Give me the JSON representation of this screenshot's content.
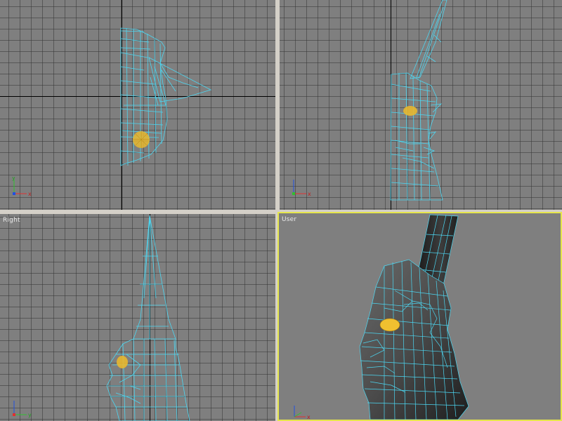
{
  "viewports": {
    "top": {
      "label": ""
    },
    "front": {
      "label": ""
    },
    "right": {
      "label": "Right"
    },
    "user": {
      "label": "User"
    }
  },
  "colors": {
    "viewport_bg": "#7f7f7f",
    "grid": "#5a5a5a",
    "wire": "#4cd7f2",
    "eye": "#e8b830",
    "active_border": "#e6e64c"
  },
  "icons": [
    "axis-tripod-icon"
  ],
  "axis_tripod": {
    "x": "x",
    "y": "y"
  }
}
